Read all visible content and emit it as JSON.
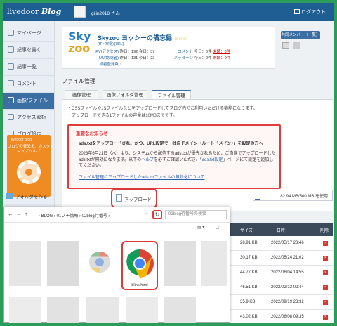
{
  "header": {
    "logo_main": "livedoor",
    "logo_blog": "Blog",
    "username": "gijin2018 さん",
    "logout": "ログアウト"
  },
  "sidebar": {
    "items": [
      {
        "label": "マイページ",
        "icon": "home-icon"
      },
      {
        "label": "記事を書く",
        "icon": "pencil-icon"
      },
      {
        "label": "記事一覧",
        "icon": "list-icon"
      },
      {
        "label": "コメント",
        "icon": "comment-icon"
      },
      {
        "label": "画像/ファイル",
        "icon": "image-icon"
      },
      {
        "label": "アクセス解析",
        "icon": "chart-icon"
      },
      {
        "label": "ブログ設定",
        "icon": "gear-icon"
      }
    ],
    "promo_logo": "livedoor Blog",
    "promo_text": "ブログの見栄え、カスタマイズヘルプ"
  },
  "profile": {
    "logo_1": "Sky",
    "logo_2": "zoo",
    "blog_name": "Skyzoo ヨッシーの備忘録",
    "stars": "☆☆☆",
    "blog_url": "(IT・家電) [URL]",
    "stats": {
      "pv_label": "PV(アクセス)",
      "pv_yesterday": "昨日：192",
      "pv_today": "今日：37",
      "uu_label": "UU(訪問者)",
      "uu_yesterday": "昨日：131",
      "uu_today": "今日：23",
      "reader_label": "読者登録数",
      "reader_count": "1",
      "comment_label": "コメント",
      "comment_today": "今日：0件",
      "comment_unread": "未読：0件",
      "message_label": "メッセージ",
      "message_today": "今日：0件",
      "message_unread": "未読：0件"
    },
    "add_member": "共同メンバー（一覧）"
  },
  "main": {
    "title": "ファイル管理",
    "tabs": [
      "画像管理",
      "画像フォルダ管理",
      "ファイル管理"
    ],
    "bullets": [
      "・CSSファイルやJSファイルなどをアップロードしてブログ内でご利用いただける機能になります。",
      "・アップロードできる1ファイルの容量は10MBまでです。"
    ],
    "notice": {
      "heading": "重要なお知らせ",
      "line1": "ads.txtをアップロードされ、かつ、URL設定で「独自ドメイン（ルートドメイン）」を設定の方へ",
      "line2a": "2023年6月21日（水）より、システムから配信するads.txtが優先されるため、ご自身でアップロードしたads.txtが無効になります。以下の",
      "line2_help": "ヘルプ",
      "line2b": "を必ずご確認いただき、「",
      "line2_setting": "ads.txt設定",
      "line2c": "」ページにて設定を追加してください。",
      "link": "ファイル管理にアップロードしたads.txtファイルの無効化について"
    },
    "new_folder": "フォルダを作る",
    "upload": "アップロード",
    "storage": "82.94 MB/500 MB を使用",
    "storage_percent": 16.6
  },
  "dialog": {
    "breadcrumb": "›  BLOG  ›  01ブチ情報  ›  02blog行番号  ›",
    "search_placeholder": "02blog行番号の検索",
    "file_label": "blink.html"
  },
  "filetable": {
    "headers": [
      "サイズ",
      "日時",
      "削除"
    ],
    "rows": [
      {
        "size": "28.91 KB",
        "date": "2022/05/17 23:46"
      },
      {
        "size": "30.17 KB",
        "date": "2022/05/24 21:02"
      },
      {
        "size": "44.77 KB",
        "date": "2022/06/04 14:55"
      },
      {
        "size": "46.51 KB",
        "date": "2022/02/12 02:44"
      },
      {
        "size": "35.9 KB",
        "date": "2022/09/19 23:32"
      },
      {
        "size": "43.02 KB",
        "date": "2022/06/08 09:35"
      }
    ]
  }
}
